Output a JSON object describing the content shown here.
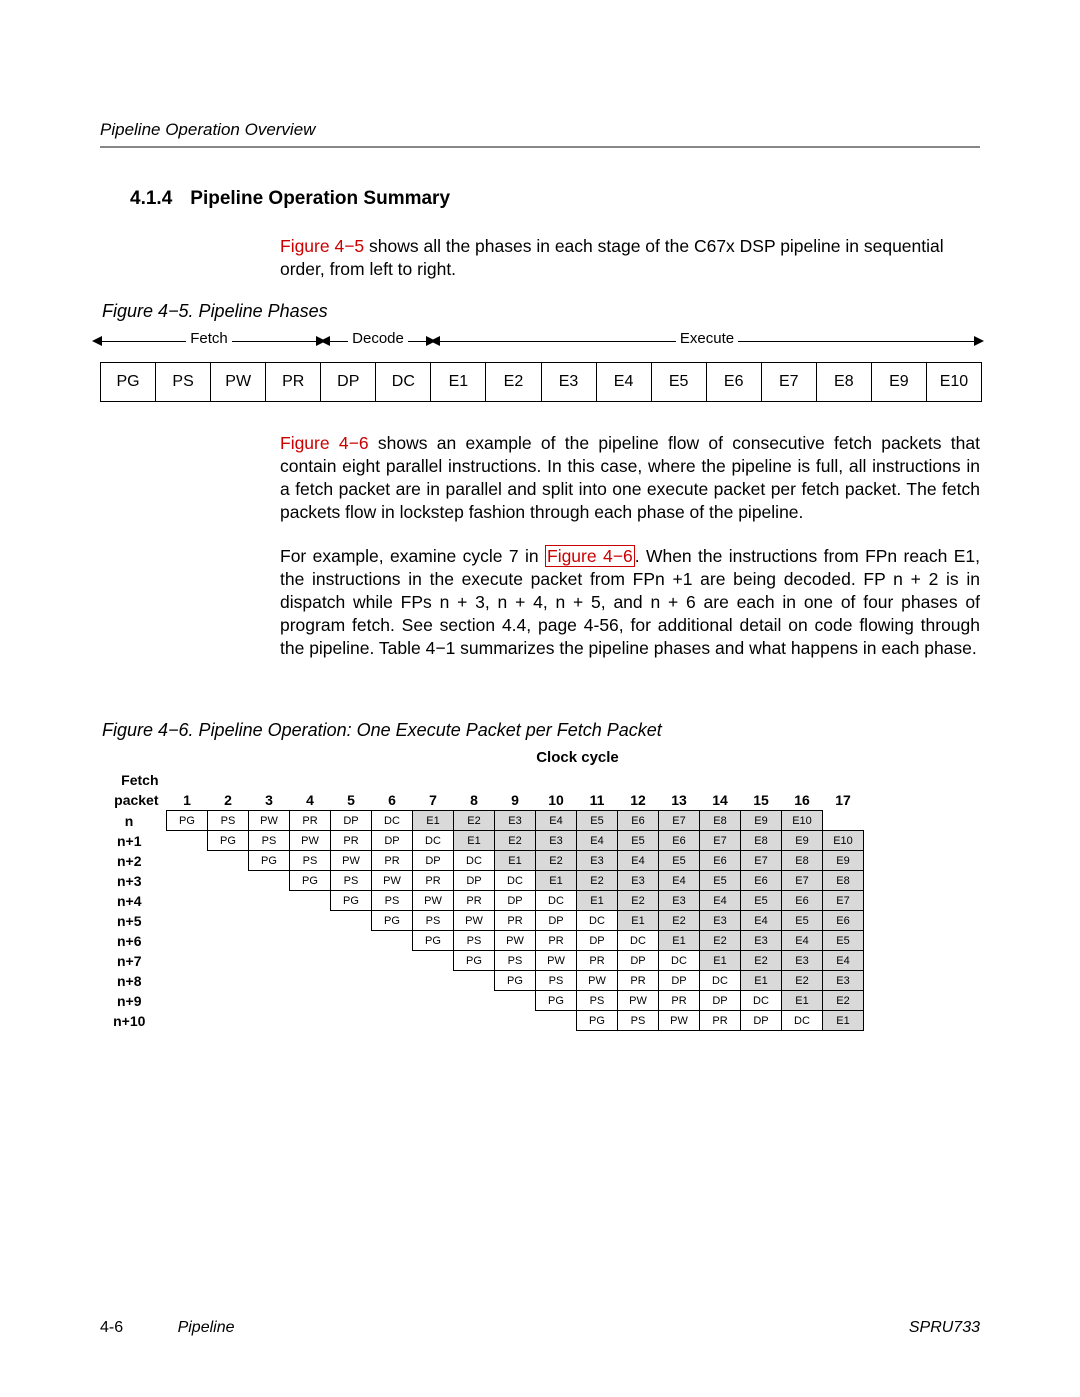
{
  "running_head": "Pipeline Operation Overview",
  "section": {
    "number": "4.1.4",
    "title": "Pipeline Operation Summary"
  },
  "para1_a": "Figure 4−5",
  "para1_b": " shows all the phases in each stage of the C67x DSP pipeline in sequential order, from left to right.",
  "fig5_caption": "Figure 4−5. Pipeline Phases",
  "stage_labels": {
    "fetch": "Fetch",
    "decode": "Decode",
    "execute": "Execute"
  },
  "phase_cells": [
    "PG",
    "PS",
    "PW",
    "PR",
    "DP",
    "DC",
    "E1",
    "E2",
    "E3",
    "E4",
    "E5",
    "E6",
    "E7",
    "E8",
    "E9",
    "E10"
  ],
  "para2_a": "Figure 4−6",
  "para2_b": " shows an example of the pipeline flow of consecutive fetch packets that contain eight parallel instructions. In this case, where the pipeline is full, all instructions in a fetch packet are in parallel and split into one execute packet per fetch packet. The fetch packets flow in lockstep fashion through each phase of the pipeline.",
  "para3_a": "For example, examine cycle 7 in ",
  "para3_link": "Figure 4−6",
  "para3_b": ". When the instructions from FPn reach E1, the instructions in the execute packet from FPn +1 are being decoded. FP n + 2 is in dispatch while FPs n + 3, n + 4, n + 5, and n + 6 are each in one of four phases of program fetch. See section 4.4, page 4-56, for additional detail on code flowing through the pipeline. Table 4−1 summarizes the pipeline phases and what happens in each phase.",
  "fig6_caption": "Figure 4−6. Pipeline Operation: One Execute Packet per Fetch Packet",
  "clock_title": "Clock cycle",
  "fetch_header_top": "Fetch",
  "fetch_header_bot": "packet",
  "clock_cols": [
    "1",
    "2",
    "3",
    "4",
    "5",
    "6",
    "7",
    "8",
    "9",
    "10",
    "11",
    "12",
    "13",
    "14",
    "15",
    "16",
    "17"
  ],
  "seq": [
    "PG",
    "PS",
    "PW",
    "PR",
    "DP",
    "DC",
    "E1",
    "E2",
    "E3",
    "E4",
    "E5",
    "E6",
    "E7",
    "E8",
    "E9",
    "E10"
  ],
  "rows": [
    "n",
    "n+1",
    "n+2",
    "n+3",
    "n+4",
    "n+5",
    "n+6",
    "n+7",
    "n+8",
    "n+9",
    "n+10"
  ],
  "footer": {
    "page": "4-6",
    "chapter": "Pipeline",
    "docid": "SPRU733"
  }
}
